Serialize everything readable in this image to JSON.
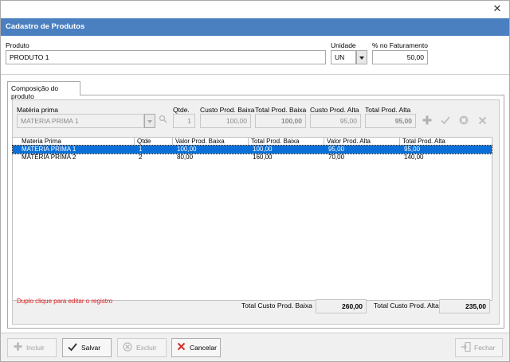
{
  "window": {
    "close_glyph": "✕"
  },
  "header": {
    "title": "Cadastro de Produtos"
  },
  "form": {
    "produto_label": "Produto",
    "produto_value": "PRODUTO 1",
    "unidade_label": "Unidade",
    "unidade_value": "UN",
    "faturamento_label": "% no Faturamento",
    "faturamento_value": "50,00"
  },
  "tab": {
    "label": "Composição do produto"
  },
  "composition": {
    "materia_label": "Matéria prima",
    "materia_value": "MATERIA PRIMA 1",
    "qtde_label": "Qtde.",
    "qtde_value": "1",
    "custo_baixa_label": "Custo Prod. Baixa",
    "custo_baixa_value": "100,00",
    "total_baixa_label": "Total Prod. Baixa",
    "total_baixa_value": "100,00",
    "custo_alta_label": "Custo Prod. Alta",
    "custo_alta_value": "95,00",
    "total_alta_label": "Total Prod. Alta",
    "total_alta_value": "95,00",
    "icons": [
      "plus-icon",
      "check-icon",
      "cancel-circle-icon",
      "close-icon"
    ]
  },
  "grid": {
    "columns": [
      "Materia Prima",
      "Qtde",
      "Valor Prod. Baixa",
      "Total Prod. Baixa",
      "Valor Prod. Alta",
      "Total Prod. Alta"
    ],
    "rows": [
      [
        "MATERIA PRIMA 1",
        "1",
        "100,00",
        "100,00",
        "95,00",
        "95,00"
      ],
      [
        "MATÉRIA PRIMA 2",
        "2",
        "80,00",
        "160,00",
        "70,00",
        "140,00"
      ]
    ],
    "selected_row": 0
  },
  "hint": "Duplo clique para editar o registro",
  "totals": {
    "baixa_label": "Total Custo Prod. Baixa",
    "baixa_value": "260,00",
    "alta_label": "Total Custo Prod. Alta",
    "alta_value": "235,00"
  },
  "footer": {
    "incluir": "Incluir",
    "salvar": "Salvar",
    "excluir": "Excluir",
    "cancelar": "Cancelar",
    "fechar": "Fechar"
  },
  "colors": {
    "header_bg": "#4a7fc0",
    "selection": "#0a6fd8",
    "hint": "#e02020",
    "cancel_red": "#d0302a"
  }
}
